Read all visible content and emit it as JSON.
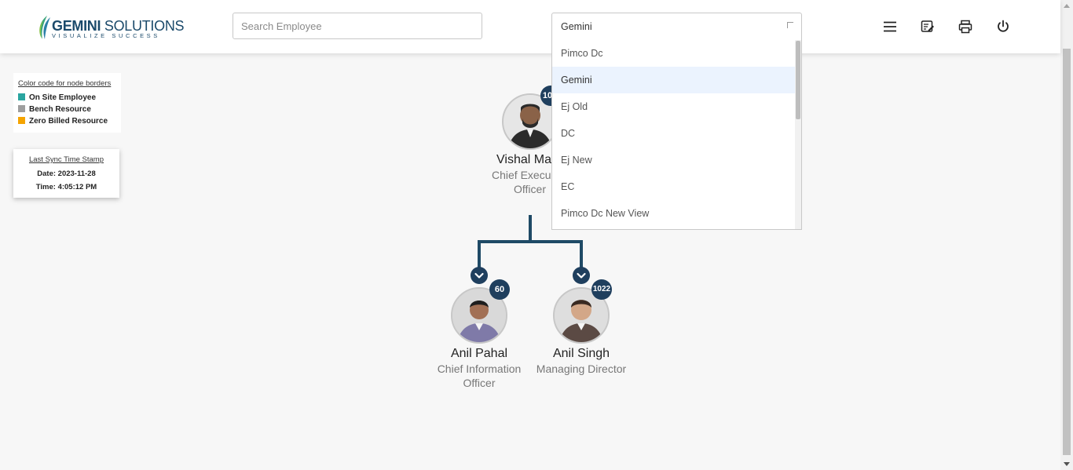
{
  "header": {
    "logo_main_bold": "GEMINI",
    "logo_main_rest": " SOLUTIONS",
    "logo_tagline": "VISUALIZE SUCCESS",
    "search_placeholder": "Search Employee",
    "view_select_value": "Gemini",
    "view_options": [
      "Pimco Dc",
      "Gemini",
      "Ej Old",
      "DC",
      "Ej New",
      "EC",
      "Pimco Dc New View"
    ],
    "selected_option": "Gemini",
    "icons": [
      "menu-icon",
      "edit-note-icon",
      "print-icon",
      "power-icon"
    ]
  },
  "legend": {
    "title": "Color code for node borders",
    "items": [
      {
        "label": "On Site Employee",
        "color": "#2aa5a0"
      },
      {
        "label": "Bench Resource",
        "color": "#9e9e9e"
      },
      {
        "label": "Zero Billed Resource",
        "color": "#f5a400"
      }
    ]
  },
  "sync": {
    "title": "Last Sync Time Stamp",
    "date": "Date: 2023-11-28",
    "time": "Time: 4:05:12 PM"
  },
  "org": {
    "root": {
      "name": "Vishal Ma",
      "title_line1": "Chief Execu",
      "title_line2": "Officer",
      "count": "10"
    },
    "children": [
      {
        "name": "Anil Pahal",
        "title_line1": "Chief Information",
        "title_line2": "Officer",
        "count": "60"
      },
      {
        "name": "Anil Singh",
        "title_line1": "Managing Director",
        "title_line2": "",
        "count": "1022"
      }
    ]
  },
  "colors": {
    "accent": "#1f3f5e",
    "connector": "#1f4a66",
    "selected_bg": "#ebf3fe"
  }
}
